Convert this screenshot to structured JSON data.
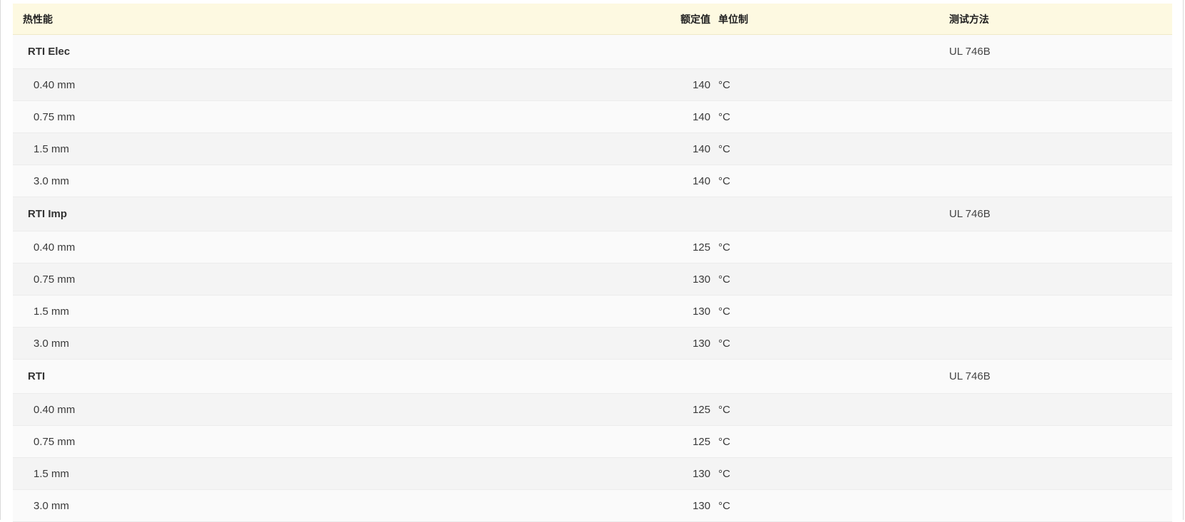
{
  "table": {
    "headers": {
      "property": "热性能",
      "value": "额定值",
      "unit": "单位制",
      "method": "测试方法"
    },
    "groups": [
      {
        "name": "RTI Elec",
        "method": "UL 746B",
        "rows": [
          {
            "thickness": "0.40 mm",
            "value": "140",
            "unit": "°C"
          },
          {
            "thickness": "0.75 mm",
            "value": "140",
            "unit": "°C"
          },
          {
            "thickness": "1.5 mm",
            "value": "140",
            "unit": "°C"
          },
          {
            "thickness": "3.0 mm",
            "value": "140",
            "unit": "°C"
          }
        ]
      },
      {
        "name": "RTI Imp",
        "method": "UL 746B",
        "rows": [
          {
            "thickness": "0.40 mm",
            "value": "125",
            "unit": "°C"
          },
          {
            "thickness": "0.75 mm",
            "value": "130",
            "unit": "°C"
          },
          {
            "thickness": "1.5 mm",
            "value": "130",
            "unit": "°C"
          },
          {
            "thickness": "3.0 mm",
            "value": "130",
            "unit": "°C"
          }
        ]
      },
      {
        "name": "RTI",
        "method": "UL 746B",
        "rows": [
          {
            "thickness": "0.40 mm",
            "value": "125",
            "unit": "°C"
          },
          {
            "thickness": "0.75 mm",
            "value": "125",
            "unit": "°C"
          },
          {
            "thickness": "1.5 mm",
            "value": "130",
            "unit": "°C"
          },
          {
            "thickness": "3.0 mm",
            "value": "130",
            "unit": "°C"
          }
        ]
      }
    ]
  }
}
